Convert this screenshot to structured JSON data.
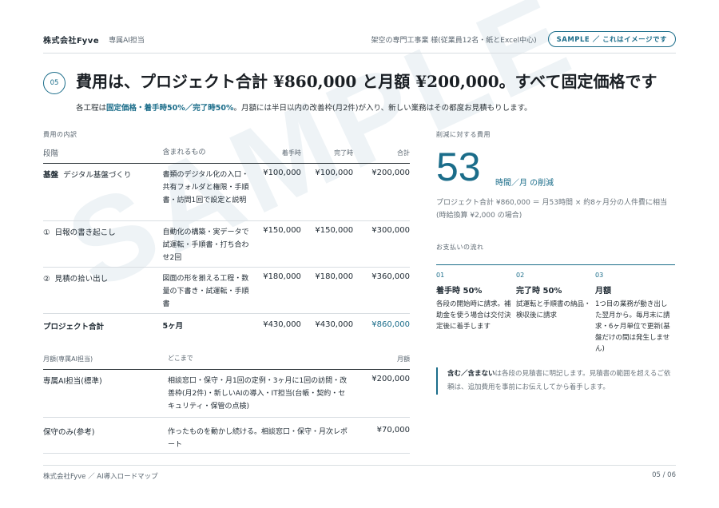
{
  "watermark": "SAMPLE",
  "header": {
    "brand": "株式会社Fyve",
    "brand_sub": "専属AI担当",
    "client": "架空の専門工事業 様(従業員12名・紙とExcel中心)",
    "sample_badge": "SAMPLE ／ これはイメージです"
  },
  "section_number": "05",
  "title": "費用は、プロジェクト合計 ¥860,000 と月額 ¥200,000。すべて固定価格です",
  "subtitle": {
    "prefix": "各工程は",
    "highlight": "固定価格・着手時50%／完了時50%",
    "suffix": "。月額には半日以内の改善枠(月2件)が入り、新しい業務はその都度お見積もりします。"
  },
  "cost_table": {
    "section_label": "費用の内訳",
    "headers": [
      "段階",
      "含まれるもの",
      "着手時",
      "完了時",
      "合計"
    ],
    "rows": [
      {
        "stage_prefix": "基盤",
        "stage": "デジタル基盤づくり",
        "includes": "書類のデジタル化の入口・共有フォルダと権限・手順書・訪問1回で設定と説明",
        "start": "¥100,000",
        "end": "¥100,000",
        "total": "¥200,000"
      },
      {
        "stage_prefix": "①",
        "stage": "日報の書き起こし",
        "includes": "自動化の構築・実データで試運転・手順書・打ち合わせ2回",
        "start": "¥150,000",
        "end": "¥150,000",
        "total": "¥300,000"
      },
      {
        "stage_prefix": "②",
        "stage": "見積の拾い出し",
        "includes": "図面の形を揃える工程・数量の下書き・試運転・手順書",
        "start": "¥180,000",
        "end": "¥180,000",
        "total": "¥360,000"
      }
    ],
    "total_row": {
      "label": "プロジェクト合計",
      "duration": "5ヶ月",
      "start": "¥430,000",
      "end": "¥430,000",
      "total": "¥860,000"
    }
  },
  "monthly_table": {
    "headers": [
      "月額(専属AI担当)",
      "どこまで",
      "月額"
    ],
    "rows": [
      {
        "name": "専属AI担当(標準)",
        "scope": "相談窓口・保守・月1回の定例・3ヶ月に1回の訪問・改善枠(月2件)・新しいAIの導入・IT担当(台帳・契約・セキュリティ・保管の点検)",
        "price": "¥200,000"
      },
      {
        "name": "保守のみ(参考)",
        "scope": "作ったものを動かし続ける。相談窓口・保守・月次レポート",
        "price": "¥70,000"
      }
    ]
  },
  "savings": {
    "label": "削減に対する費用",
    "value": "53",
    "unit": "時間／月 の削減",
    "calc": "プロジェクト合計 ¥860,000 ＝ 月53時間 × 約8ヶ月分の人件費に相当(時給換算 ¥2,000 の場合)"
  },
  "payment_flow": {
    "label": "お支払いの流れ",
    "steps": [
      {
        "num": "01",
        "head": "着手時 50%",
        "body": "各段の開始時に請求。補助金を使う場合は交付決定後に着手します"
      },
      {
        "num": "02",
        "head": "完了時 50%",
        "body": "試運転と手順書の納品・検収後に請求"
      },
      {
        "num": "03",
        "head": "月額",
        "body": "1つ目の業務が動き出した翌月から。毎月末に請求・6ヶ月単位で更新(基盤だけの間は発生しません)"
      }
    ]
  },
  "note": {
    "bold": "含む／含まない",
    "text": "は各段の見積書に明記します。見積書の範囲を超えるご依頼は、追加費用を事前にお伝えしてから着手します。"
  },
  "footer": {
    "left": "株式会社Fyve ／ AI導入ロードマップ",
    "page": "05 / 06"
  },
  "colors": {
    "accent": "#1b6d8a",
    "text": "#1f2a33",
    "muted": "#5a6670",
    "rule": "#d9dee2"
  }
}
